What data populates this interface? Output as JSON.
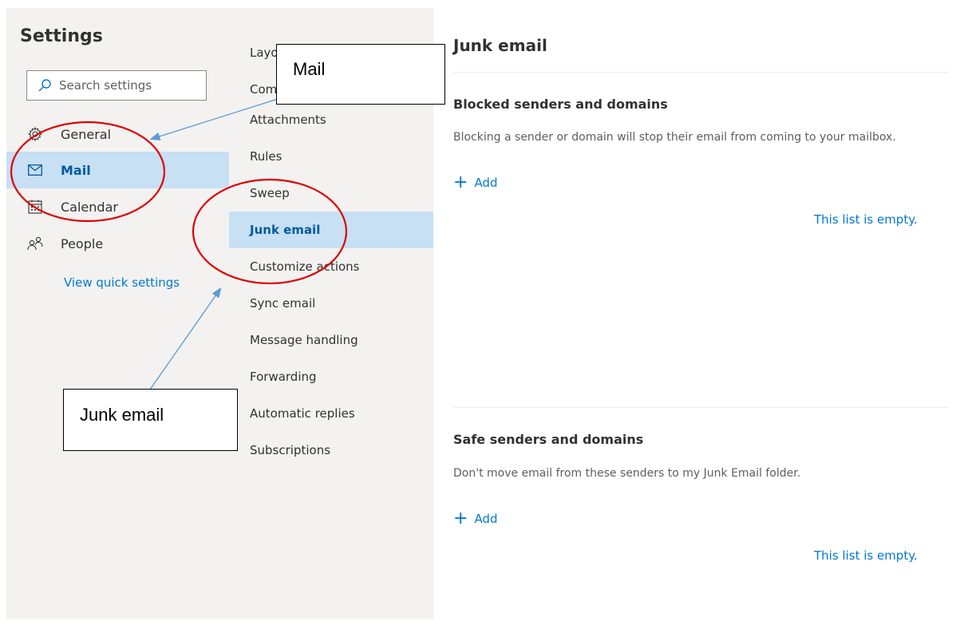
{
  "settings_panel": {
    "title": "Settings",
    "search_placeholder": "Search settings",
    "nav_items": [
      {
        "label": "General",
        "icon": "gear-icon"
      },
      {
        "label": "Mail",
        "icon": "mail-icon",
        "selected": true
      },
      {
        "label": "Calendar",
        "icon": "calendar-icon"
      },
      {
        "label": "People",
        "icon": "people-icon"
      }
    ],
    "quick_settings_link": "View quick settings"
  },
  "mail_subnav": {
    "items": [
      {
        "label": "Layout"
      },
      {
        "label": "Compose and reply"
      },
      {
        "label": "Attachments"
      },
      {
        "label": "Rules"
      },
      {
        "label": "Sweep"
      },
      {
        "label": "Junk email",
        "selected": true
      },
      {
        "label": "Customize actions"
      },
      {
        "label": "Sync email"
      },
      {
        "label": "Message handling"
      },
      {
        "label": "Forwarding"
      },
      {
        "label": "Automatic replies"
      },
      {
        "label": "Subscriptions"
      }
    ]
  },
  "main": {
    "title": "Junk email",
    "blocked": {
      "title": "Blocked senders and domains",
      "description": "Blocking a sender or domain will stop their email from coming to your mailbox.",
      "add_label": "Add",
      "empty_text": "This list is empty."
    },
    "safe": {
      "title": "Safe senders and domains",
      "description": "Don't move email from these senders to my Junk Email folder.",
      "add_label": "Add",
      "empty_text": "This list is empty."
    }
  },
  "annotations": {
    "mail_callout": "Mail",
    "junk_callout": "Junk email",
    "circle_color": "#e00000",
    "arrow_color": "#5b9bd5"
  },
  "colors": {
    "accent": "#0078d4",
    "selected_bg": "#c7e0f4",
    "pane_bg": "#f3f2f1"
  }
}
